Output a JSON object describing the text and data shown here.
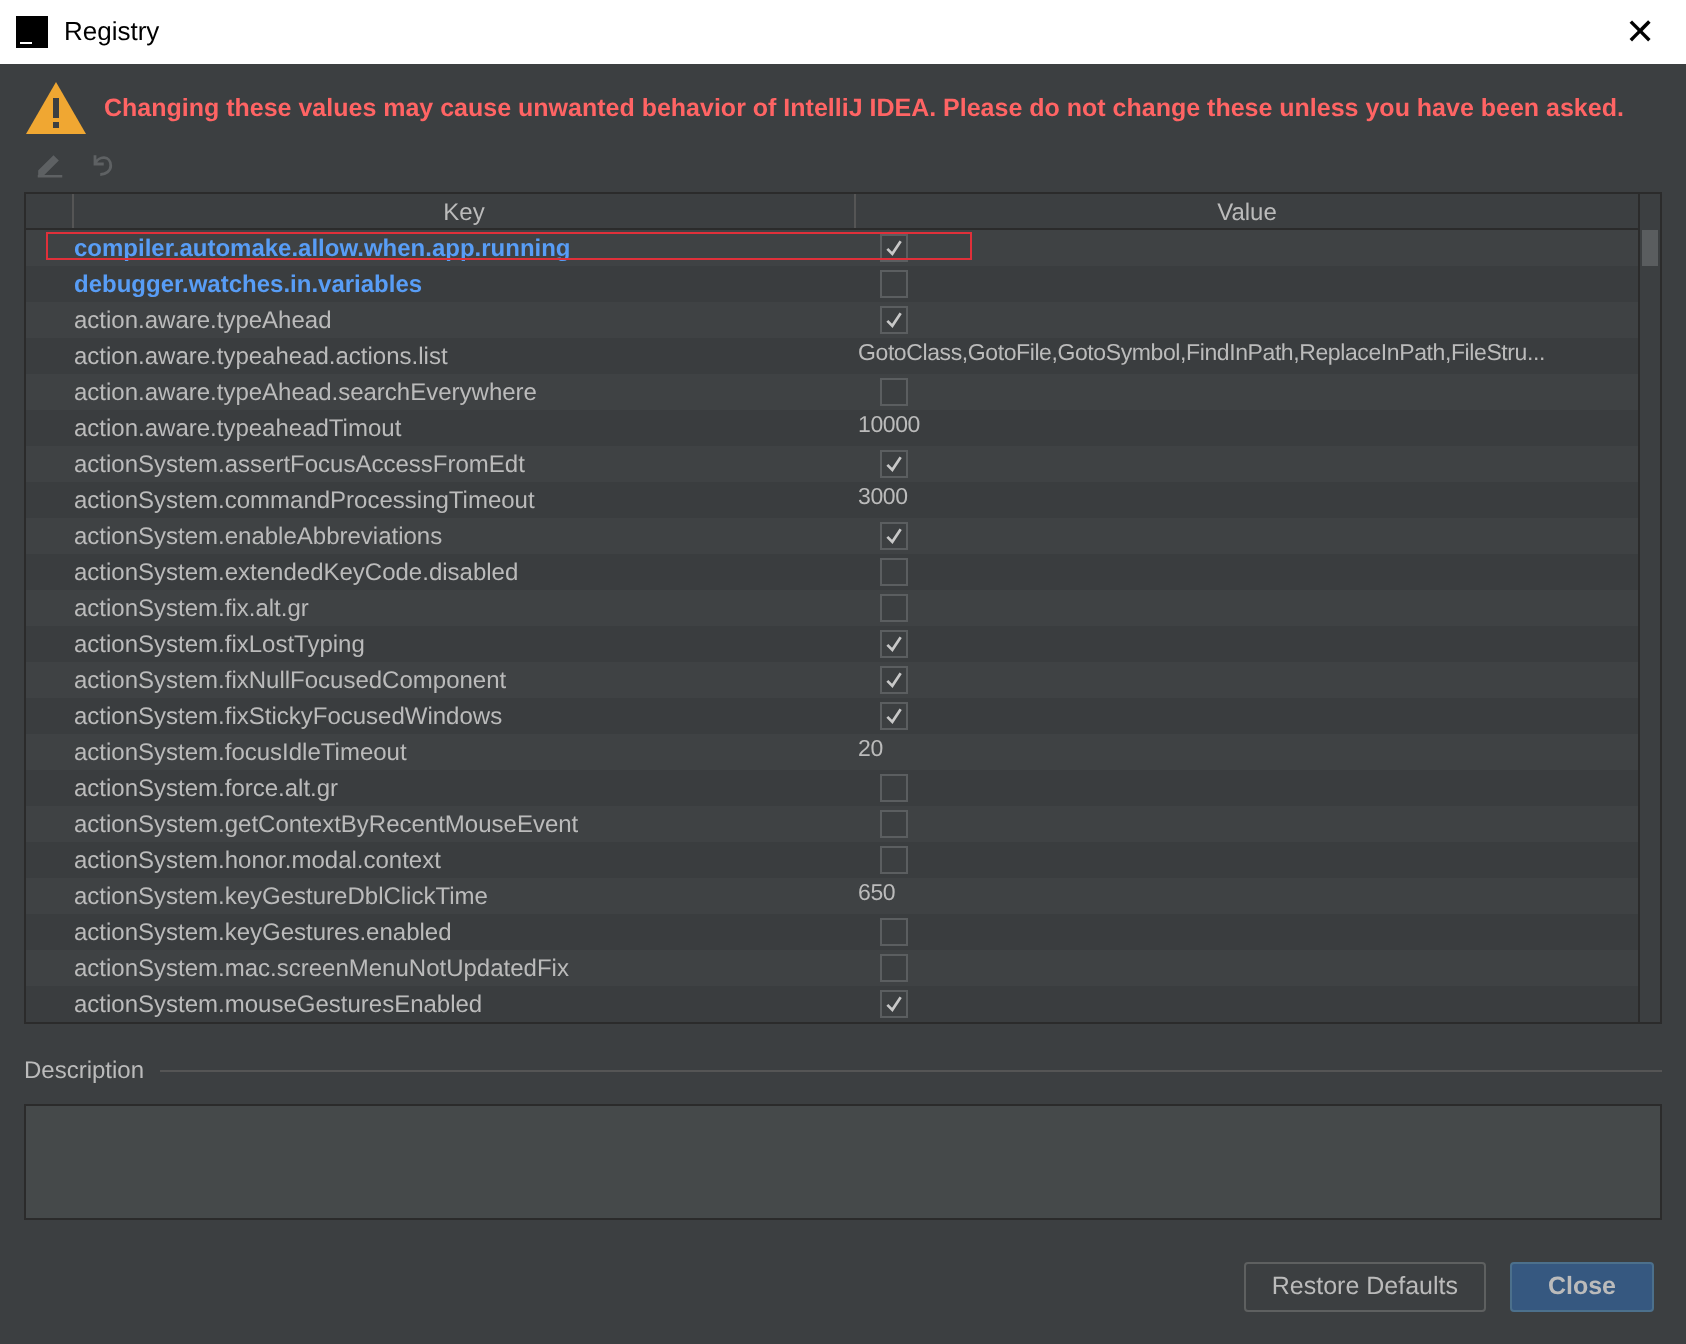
{
  "window": {
    "title": "Registry",
    "close": "✕"
  },
  "warning": "Changing these values may cause unwanted behavior of IntelliJ IDEA. Please do not change these unless you have been asked.",
  "table": {
    "columns": [
      "Key",
      "Value"
    ],
    "rows": [
      {
        "key": "compiler.automake.allow.when.app.running",
        "kind": "bool",
        "checked": true,
        "modified": true,
        "highlighted": true
      },
      {
        "key": "debugger.watches.in.variables",
        "kind": "bool",
        "checked": false,
        "modified": true,
        "highlighted": false
      },
      {
        "key": "action.aware.typeAhead",
        "kind": "bool",
        "checked": true,
        "modified": false,
        "highlighted": false
      },
      {
        "key": "action.aware.typeahead.actions.list",
        "kind": "text",
        "value": "GotoClass,GotoFile,GotoSymbol,FindInPath,ReplaceInPath,FileStru...",
        "modified": false,
        "highlighted": false
      },
      {
        "key": "action.aware.typeAhead.searchEverywhere",
        "kind": "bool",
        "checked": false,
        "modified": false,
        "highlighted": false
      },
      {
        "key": "action.aware.typeaheadTimout",
        "kind": "text",
        "value": "10000",
        "modified": false,
        "highlighted": false
      },
      {
        "key": "actionSystem.assertFocusAccessFromEdt",
        "kind": "bool",
        "checked": true,
        "modified": false,
        "highlighted": false
      },
      {
        "key": "actionSystem.commandProcessingTimeout",
        "kind": "text",
        "value": "3000",
        "modified": false,
        "highlighted": false
      },
      {
        "key": "actionSystem.enableAbbreviations",
        "kind": "bool",
        "checked": true,
        "modified": false,
        "highlighted": false
      },
      {
        "key": "actionSystem.extendedKeyCode.disabled",
        "kind": "bool",
        "checked": false,
        "modified": false,
        "highlighted": false
      },
      {
        "key": "actionSystem.fix.alt.gr",
        "kind": "bool",
        "checked": false,
        "modified": false,
        "highlighted": false
      },
      {
        "key": "actionSystem.fixLostTyping",
        "kind": "bool",
        "checked": true,
        "modified": false,
        "highlighted": false
      },
      {
        "key": "actionSystem.fixNullFocusedComponent",
        "kind": "bool",
        "checked": true,
        "modified": false,
        "highlighted": false
      },
      {
        "key": "actionSystem.fixStickyFocusedWindows",
        "kind": "bool",
        "checked": true,
        "modified": false,
        "highlighted": false
      },
      {
        "key": "actionSystem.focusIdleTimeout",
        "kind": "text",
        "value": "20",
        "modified": false,
        "highlighted": false
      },
      {
        "key": "actionSystem.force.alt.gr",
        "kind": "bool",
        "checked": false,
        "modified": false,
        "highlighted": false
      },
      {
        "key": "actionSystem.getContextByRecentMouseEvent",
        "kind": "bool",
        "checked": false,
        "modified": false,
        "highlighted": false
      },
      {
        "key": "actionSystem.honor.modal.context",
        "kind": "bool",
        "checked": false,
        "modified": false,
        "highlighted": false
      },
      {
        "key": "actionSystem.keyGestureDblClickTime",
        "kind": "text",
        "value": "650",
        "modified": false,
        "highlighted": false
      },
      {
        "key": "actionSystem.keyGestures.enabled",
        "kind": "bool",
        "checked": false,
        "modified": false,
        "highlighted": false
      },
      {
        "key": "actionSystem.mac.screenMenuNotUpdatedFix",
        "kind": "bool",
        "checked": false,
        "modified": false,
        "highlighted": false
      },
      {
        "key": "actionSystem.mouseGesturesEnabled",
        "kind": "bool",
        "checked": true,
        "modified": false,
        "highlighted": false
      }
    ]
  },
  "description": {
    "label": "Description"
  },
  "buttons": [
    {
      "label": "Restore Defaults",
      "default": false
    },
    {
      "label": "Close",
      "default": true
    }
  ]
}
